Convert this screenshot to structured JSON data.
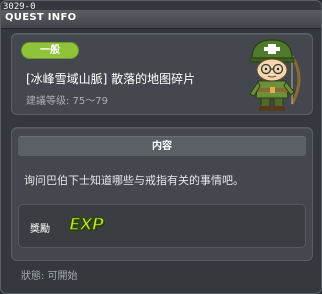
{
  "window": {
    "quest_id": "3029-0",
    "title": "QUEST INFO"
  },
  "quest": {
    "category_badge": "一般",
    "name": "[冰峰雪域山脈] 散落的地图碎片",
    "recommended_level": "建議等级: 75～79",
    "npc_icon": "npc-soldier-portrait"
  },
  "content": {
    "header": "内容",
    "description": "询问巴伯下士知道哪些与戒指有关的事情吧。",
    "reward_label": "獎勵",
    "reward_icon": "EXP"
  },
  "status": {
    "text": "狀態:  可開始"
  },
  "colors": {
    "badge_green": "#8fc43a",
    "exp_green": "#c9e82a",
    "title_accent": "#c8b54a"
  }
}
